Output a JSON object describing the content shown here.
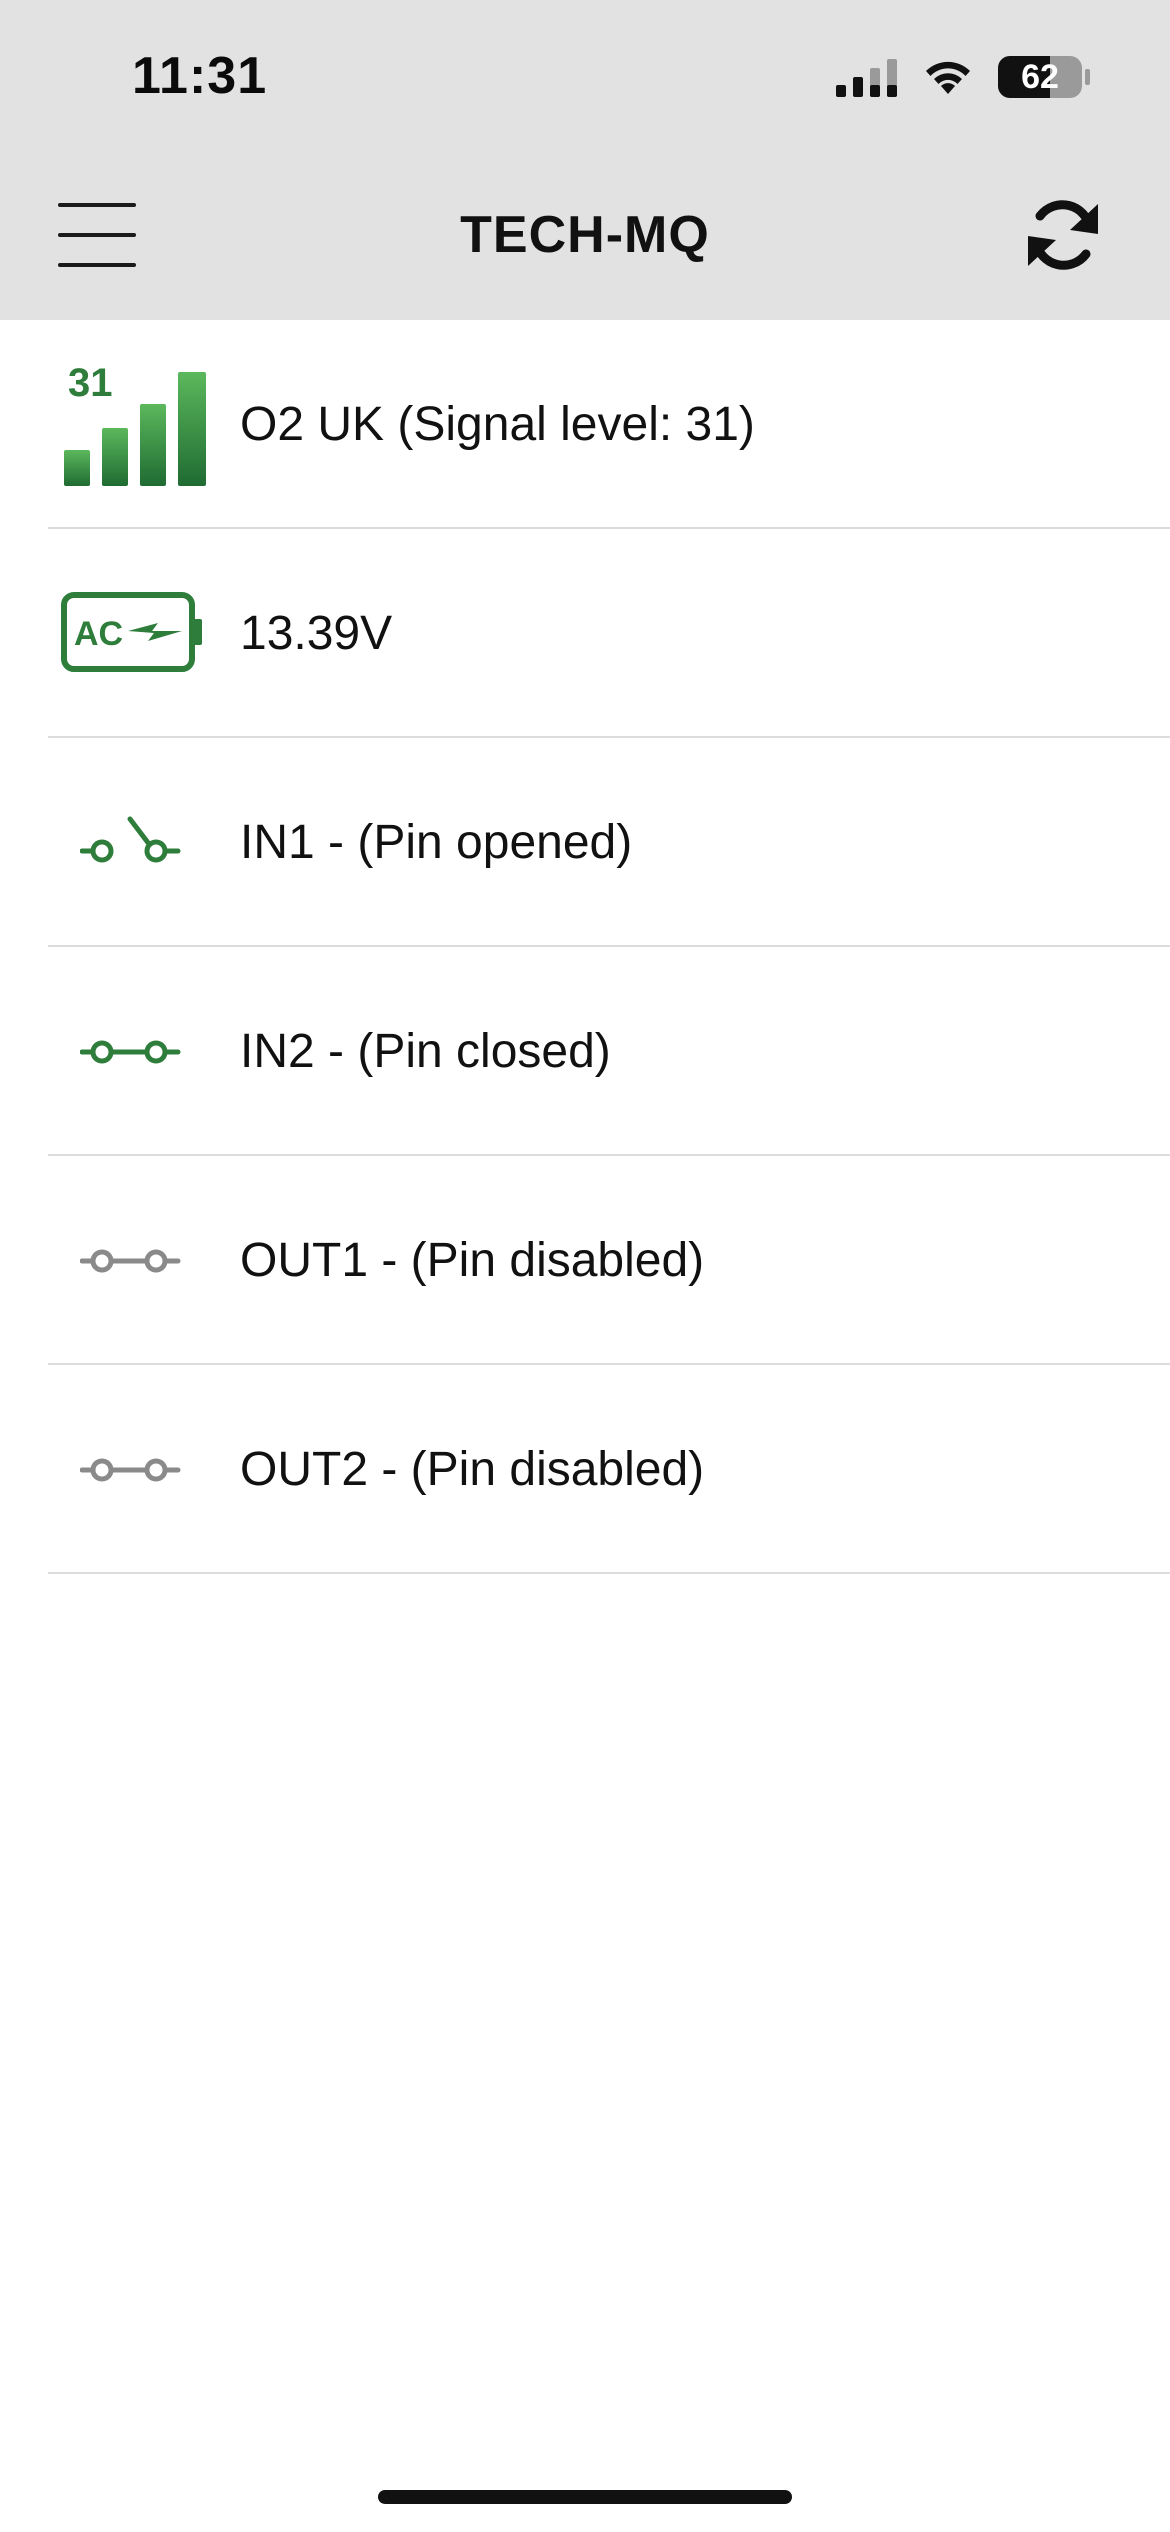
{
  "status_bar": {
    "time": "11:31",
    "battery_level": "62",
    "cell_icon": "cellular-signal-icon",
    "wifi_icon": "wifi-icon",
    "battery_icon": "battery-icon"
  },
  "header": {
    "title": "TECH-MQ",
    "menu_icon": "hamburger-menu-icon",
    "refresh_icon": "refresh-icon"
  },
  "items": [
    {
      "label": "O2 UK (Signal level: 31)",
      "icon": "signal-strength-icon",
      "icon_text": "31",
      "state": "active"
    },
    {
      "label": "13.39V",
      "icon": "ac-power-icon",
      "icon_text": "AC",
      "state": "active"
    },
    {
      "label": "IN1 - (Pin opened)",
      "icon": "switch-open-icon",
      "state": "active"
    },
    {
      "label": "IN2 - (Pin closed)",
      "icon": "switch-closed-icon",
      "state": "active"
    },
    {
      "label": "OUT1 - (Pin disabled)",
      "icon": "switch-disabled-icon",
      "state": "disabled"
    },
    {
      "label": "OUT2 - (Pin disabled)",
      "icon": "switch-disabled-icon",
      "state": "disabled"
    }
  ],
  "colors": {
    "header_background": "#e2e2e2",
    "active_green": "#2e7d3b",
    "disabled_gray": "#8a8a8a",
    "divider": "#dcdcdc"
  }
}
